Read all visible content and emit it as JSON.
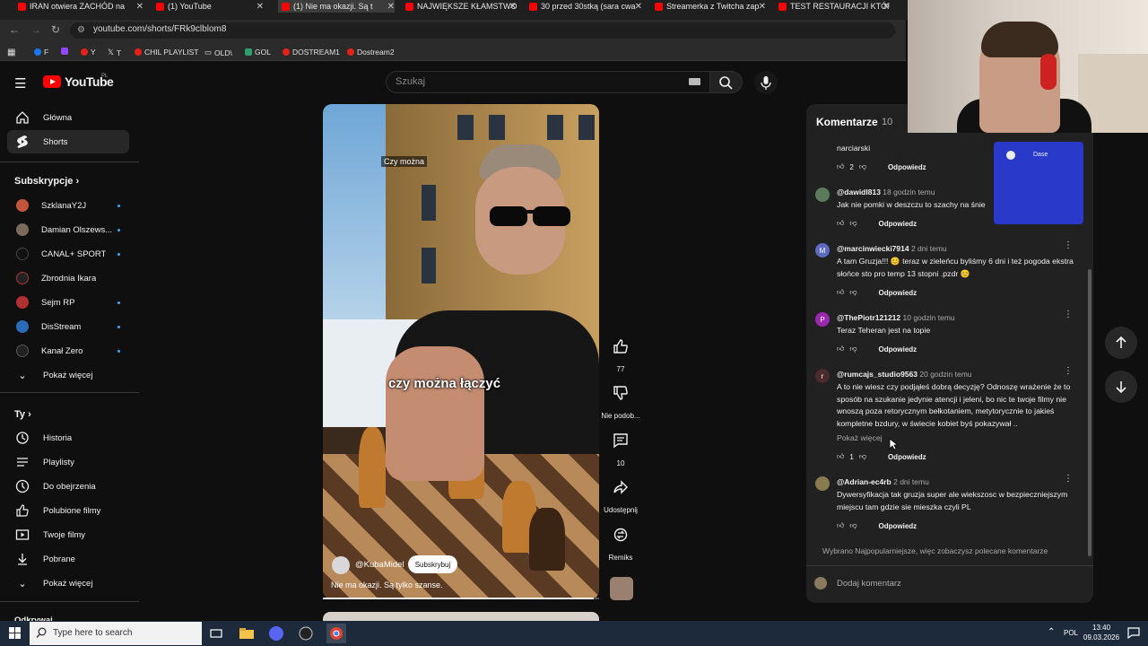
{
  "browser": {
    "tabs": [
      {
        "label": "IRAN otwiera ZACHÓD na",
        "active": false
      },
      {
        "label": "(1) YouTube",
        "active": false
      },
      {
        "label": "(1) Nie ma okazji. Są t",
        "active": true
      },
      {
        "label": "NAJWIĘKSZE KŁAMSTWO",
        "active": false
      },
      {
        "label": "30 przed 30stką (sara cwa",
        "active": false
      },
      {
        "label": "Streamerka z Twitcha zap",
        "active": false
      },
      {
        "label": "TEST RESTAURACJI KTÓR",
        "active": false
      }
    ],
    "url": "youtube.com/shorts/FRk9clblom8",
    "bookmarks": [
      "F",
      "",
      "Y",
      "T",
      "CHIL PLAYLIST",
      "OLD\\",
      "GOL",
      "DOSTREAM1",
      "Dostream2"
    ]
  },
  "youtube": {
    "logo_text": "YouTube",
    "region": "PL",
    "search_placeholder": "Szukaj"
  },
  "sidebar": {
    "main": [
      {
        "label": "Główna",
        "icon": "home-icon"
      },
      {
        "label": "Shorts",
        "icon": "shorts-icon",
        "active": true
      }
    ],
    "subs_heading": "Subskrypcje",
    "subs": [
      {
        "label": "SzklanaY2J",
        "color": "#c4553a",
        "dot": true
      },
      {
        "label": "Damian Olszews...",
        "color": "#7a6a5a",
        "dot": true
      },
      {
        "label": "CANAL+ SPORT",
        "color": "#111111",
        "dot": true
      },
      {
        "label": "Zbrodnia Ikara",
        "color": "#222222",
        "dot": false
      },
      {
        "label": "Sejm RP",
        "color": "#b03030",
        "dot": true
      },
      {
        "label": "DisStream",
        "color": "#2a6ab8",
        "dot": true
      },
      {
        "label": "Kanał Zero",
        "color": "#222222",
        "dot": true
      }
    ],
    "subs_more": "Pokaż więcej",
    "you_heading": "Ty",
    "you": [
      {
        "label": "Historia",
        "icon": "history-icon"
      },
      {
        "label": "Playlisty",
        "icon": "playlist-icon"
      },
      {
        "label": "Do obejrzenia",
        "icon": "clock-icon"
      },
      {
        "label": "Polubione filmy",
        "icon": "like-icon"
      },
      {
        "label": "Twoje filmy",
        "icon": "video-icon"
      },
      {
        "label": "Pobrane",
        "icon": "download-icon"
      }
    ],
    "you_more": "Pokaż więcej",
    "bottom_heading": "Odkrywaj"
  },
  "video": {
    "caption_top": "Czy można",
    "caption_mid": "czy można łączyć",
    "channel": "@KubaMidel",
    "subscribe_label": "Subskrybuj",
    "title": "Nie ma okazji. Są tylko szanse.",
    "progress": 0.98
  },
  "actions": {
    "likes": "77",
    "dislike_label": "Nie podob...",
    "comments": "10",
    "share_label": "Udostępnij",
    "remix_label": "Remiks"
  },
  "comments_panel": {
    "title": "Komentarze",
    "count": "10",
    "top_partial": "narciarski",
    "top_partial_likes": "2",
    "reply_label": "Odpowiedz",
    "items": [
      {
        "author": "@dawidl813",
        "time": "18 godzin temu",
        "text": "Jak nie pomki w deszczu to szachy na śnie",
        "likes": "",
        "avatar": "#5a7a5a",
        "letter": ""
      },
      {
        "author": "@marcinwiecki7914",
        "time": "2 dni temu",
        "text": "A tam Gruzja!!! 😊 teraz w zieleńcu byliśmy 6 dni i też pogoda ekstra słońce sto pro temp 13 stopni .pzdr 😊",
        "likes": "",
        "avatar": "#5c6bc0",
        "letter": "M"
      },
      {
        "author": "@ThePiotr121212",
        "time": "10 godzin temu",
        "text": "Teraz Teheran jest na topie",
        "likes": "",
        "avatar": "#9c27b0",
        "letter": "P"
      },
      {
        "author": "@rumcajs_studio9563",
        "time": "20 godzin temu",
        "text": "A to nie wiesz czy podjąłeś dobrą decyzję? Odnoszę wrażenie że to sposób na szukanie jedynie atencji i jeleni, bo nic te twoje filmy nie wnoszą poza retorycznym bełkotaniem, metytorycznie to jakieś kompletne bzdury, w świecie kobiet byś pokazywał ..",
        "likes": "1",
        "avatar": "#4a2a2a",
        "letter": "r",
        "more": "Pokaż więcej"
      },
      {
        "author": "@Adrian-ec4rb",
        "time": "2 dni temu",
        "text": "Dywersyfikacja tak gruzja super ale wiekszosc w bezpieczniejszym miejscu tam gdzie sie mieszka czyli PL",
        "likes": "",
        "avatar": "#8a7a50",
        "letter": ""
      }
    ],
    "footer": "Wybrano Najpopularniejsze, więc zobaczysz polecane komentarze",
    "add_placeholder": "Dodaj komentarz"
  },
  "overlay": {
    "label": "Dase"
  },
  "taskbar": {
    "search_placeholder": "Type here to search",
    "lang": "POL",
    "time": "13:40",
    "date": "09.03.2026"
  }
}
